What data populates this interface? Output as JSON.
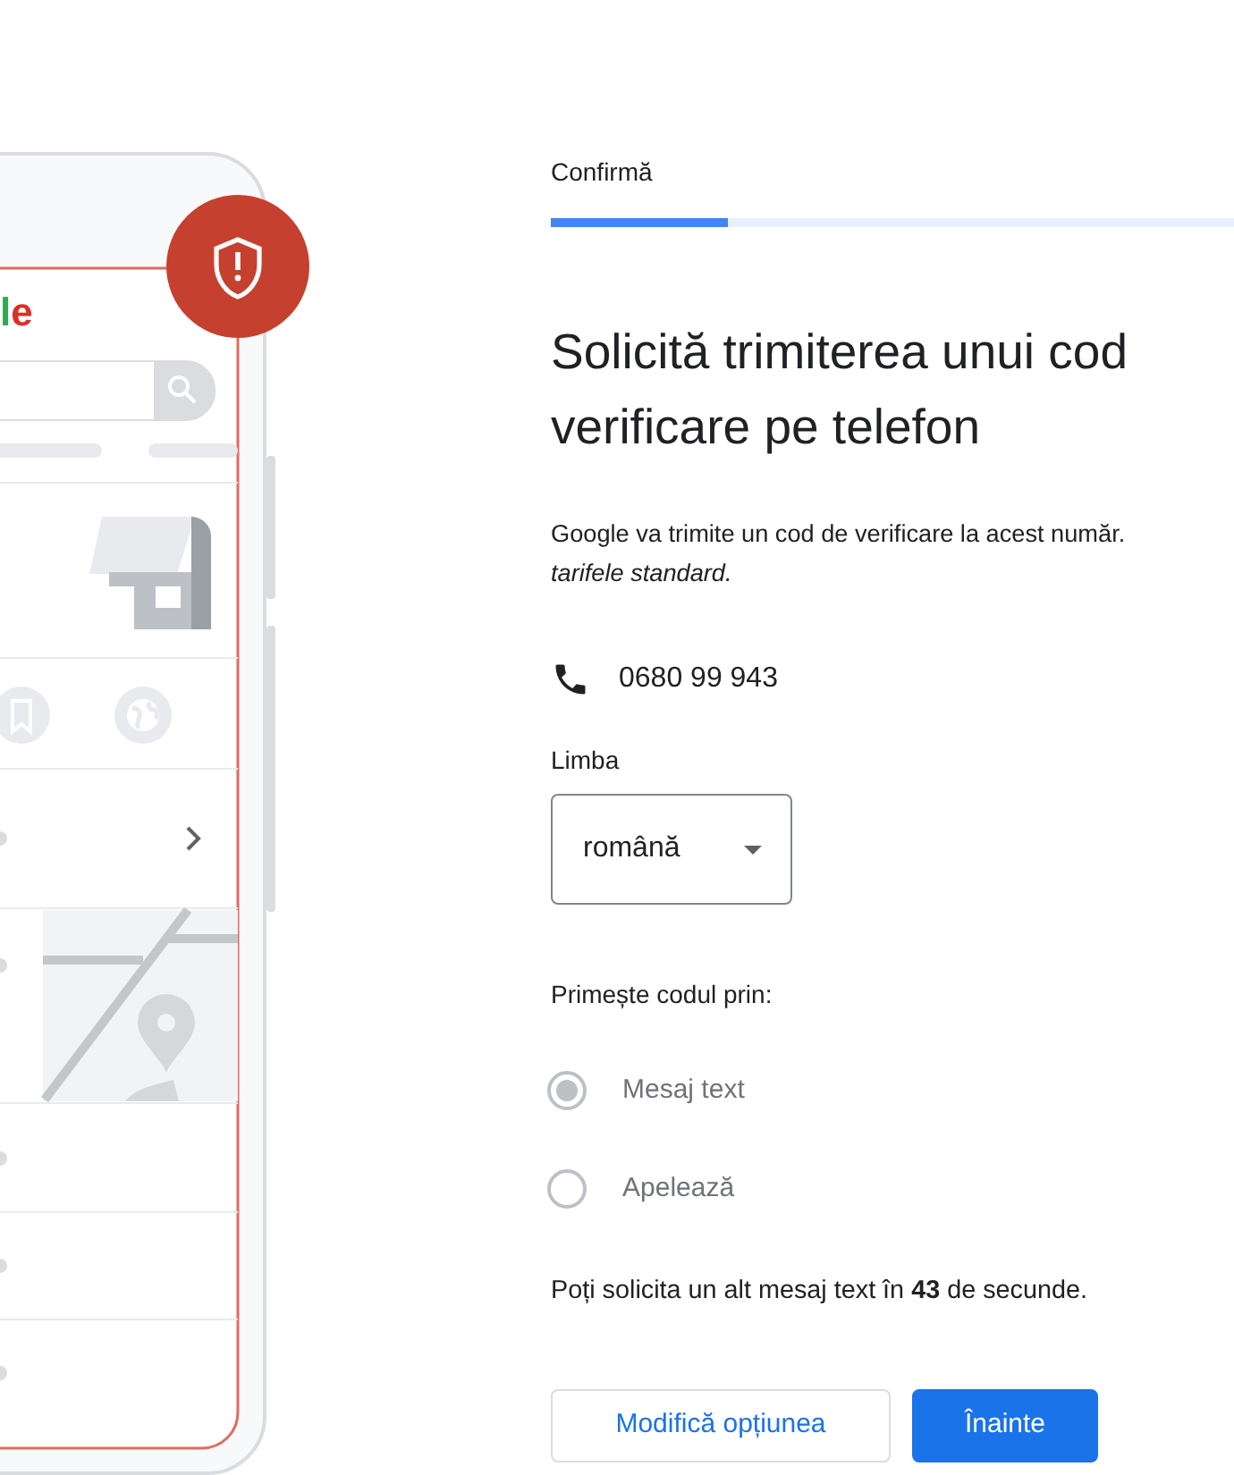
{
  "illustration": {
    "logo_text": "le"
  },
  "step": {
    "label": "Confirmă",
    "level": 0.26
  },
  "heading_lines": [
    "Solicită trimiterea unui cod",
    "verificare pe telefon"
  ],
  "notice_lines": [
    {
      "text": "Google va trimite un cod de verificare la acest număr.",
      "kind": "plain"
    },
    {
      "text": "tarifele standard.",
      "kind": "emphasis"
    }
  ],
  "phone": "0680 99 943",
  "language": {
    "label": "Limba",
    "value": "română"
  },
  "method": {
    "label": "Primește codul prin:",
    "options": [
      {
        "label": "Mesaj text",
        "selected": true,
        "disabled": true
      },
      {
        "label": "Apelează",
        "selected": false,
        "disabled": true
      }
    ]
  },
  "countdown": "Poți solicita un alt mesaj text în **43** de secunde.",
  "buttons": [
    {
      "label": "Modifică opțiunea",
      "kind": "outline"
    },
    {
      "label": "Înainte",
      "kind": "primary"
    }
  ]
}
